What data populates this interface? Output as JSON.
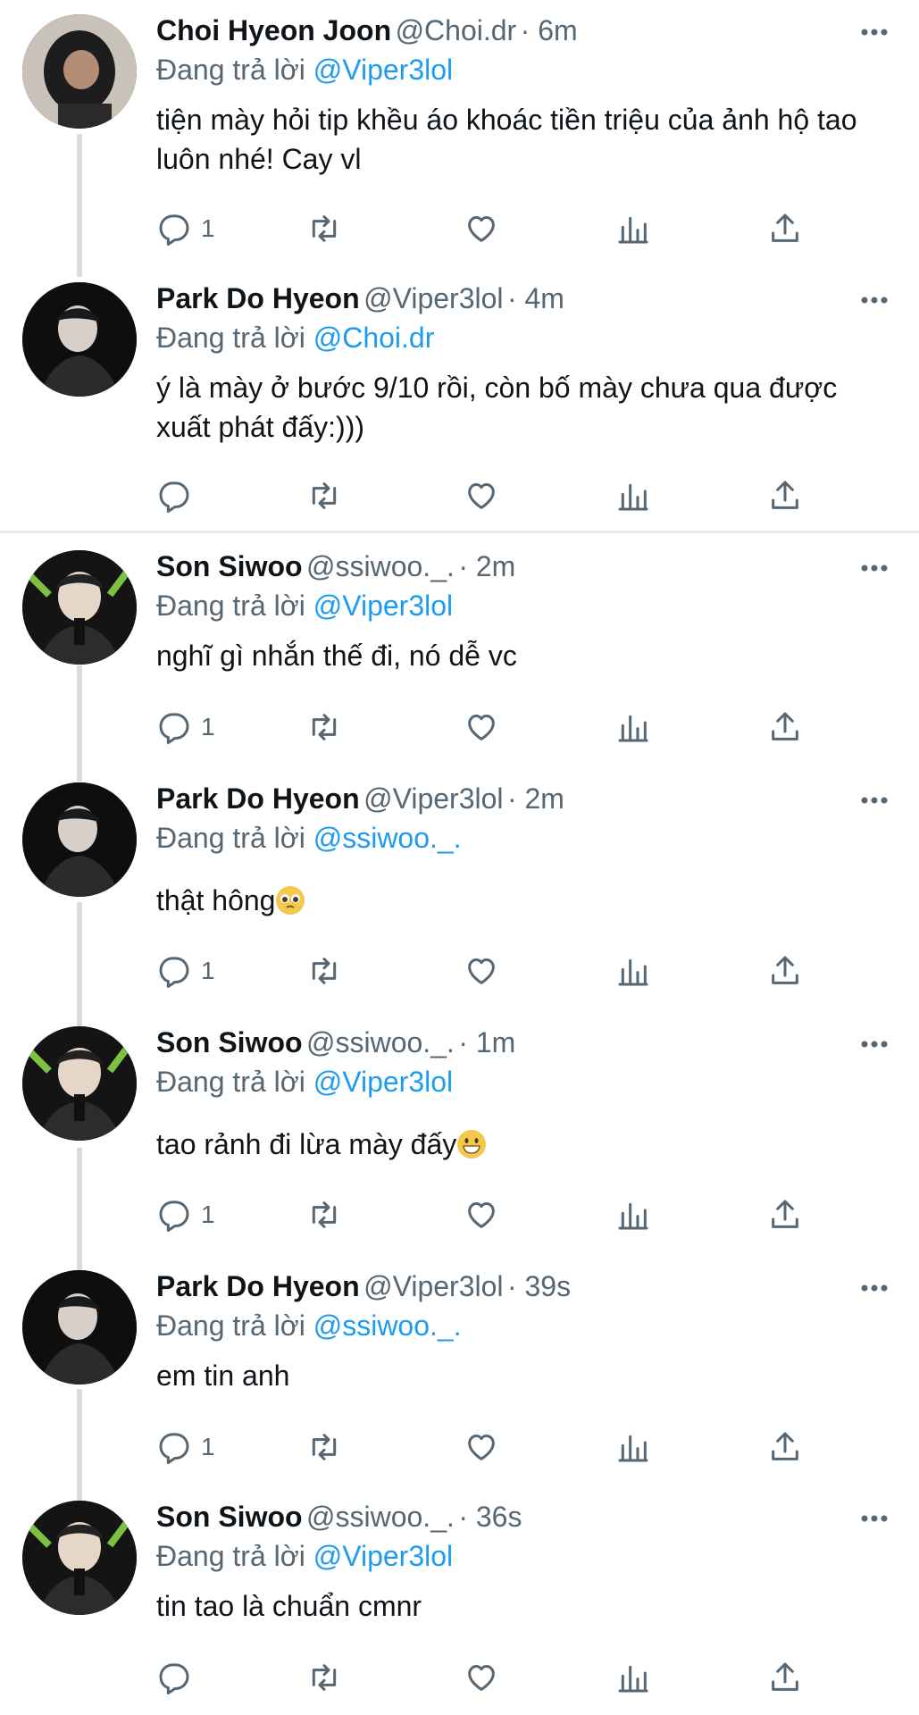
{
  "replying_prefix": "Đang trả lời",
  "tweets": [
    {
      "name": "Choi Hyeon Joon",
      "handle": "@Choi.dr",
      "time": "· 6m",
      "reply_to": "@Viper3lol",
      "text": "tiện mày hỏi tip khều áo khoác tiền triệu của ảnh hộ tao luôn nhé! Cay vl",
      "replies": "1"
    },
    {
      "name": "Park Do Hyeon",
      "handle": "@Viper3lol",
      "time": "· 4m",
      "reply_to": "@Choi.dr",
      "text": "ý là mày ở bước 9/10 rồi, còn bố mày chưa qua được xuất phát đấy:)))",
      "replies": ""
    },
    {
      "name": "Son Siwoo",
      "handle": "@ssiwoo._.",
      "time": "· 2m",
      "reply_to": "@Viper3lol",
      "text": "nghĩ gì nhắn thế đi, nó dễ vc",
      "replies": "1"
    },
    {
      "name": "Park Do Hyeon",
      "handle": "@Viper3lol",
      "time": "· 2m",
      "reply_to": "@ssiwoo._.",
      "text": "thật hông",
      "emoji": "pleading-face",
      "replies": "1"
    },
    {
      "name": "Son Siwoo",
      "handle": "@ssiwoo._.",
      "time": "· 1m",
      "reply_to": "@Viper3lol",
      "text": "tao rảnh đi lừa mày đấy",
      "emoji": "grinning-face",
      "replies": "1"
    },
    {
      "name": "Park Do Hyeon",
      "handle": "@Viper3lol",
      "time": "· 39s",
      "reply_to": "@ssiwoo._.",
      "text": "em tin anh",
      "replies": "1"
    },
    {
      "name": "Son Siwoo",
      "handle": "@ssiwoo._.",
      "time": "· 36s",
      "reply_to": "@Viper3lol",
      "text": "tin tao là chuẩn cmnr",
      "replies": ""
    }
  ],
  "colors": {
    "accent": "#1d9bf0",
    "secondary": "#566672",
    "divider": "#e6e9ec"
  }
}
